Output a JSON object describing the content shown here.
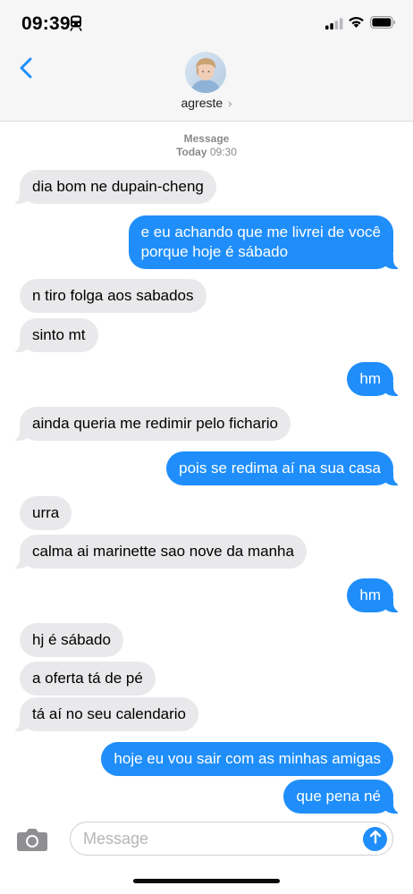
{
  "status_bar": {
    "time": "09:39",
    "icons": [
      "train-icon",
      "signal-icon",
      "wifi-icon",
      "battery-icon"
    ]
  },
  "header": {
    "back_icon": "chevron-left-icon",
    "contact_name": "agreste",
    "contact_chevron": "›"
  },
  "thread": {
    "service_label": "Message",
    "day": "Today",
    "time": "09:30"
  },
  "messages": [
    {
      "direction": "in",
      "text": "dia bom ne dupain-cheng"
    },
    {
      "direction": "out",
      "lines": [
        "e eu achando que me livrei de você",
        "porque hoje é sábado"
      ]
    },
    {
      "direction": "in",
      "text": "n tiro folga aos sabados"
    },
    {
      "direction": "in",
      "text": "sinto mt"
    },
    {
      "direction": "out",
      "text": "hm"
    },
    {
      "direction": "in",
      "text": "ainda queria me redimir pelo fichario"
    },
    {
      "direction": "out",
      "text": "pois se redima aí na sua casa"
    },
    {
      "direction": "in",
      "text": "urra"
    },
    {
      "direction": "in",
      "text": "calma ai marinette sao nove da manha"
    },
    {
      "direction": "out",
      "text": "hm"
    },
    {
      "direction": "in",
      "text": "hj é sábado"
    },
    {
      "direction": "in",
      "text": "a oferta tá de pé"
    },
    {
      "direction": "in",
      "text": "tá aí no seu calendario"
    },
    {
      "direction": "out",
      "text": "hoje eu vou sair com as minhas amigas"
    },
    {
      "direction": "out",
      "text": "que pena né"
    }
  ],
  "composer": {
    "placeholder": "Message",
    "value": "",
    "camera_icon": "camera-icon",
    "send_icon": "arrow-up-icon"
  },
  "colors": {
    "outgoing_bubble": "#1f8efa",
    "incoming_bubble": "#e9e9eb",
    "header_bg": "#f6f6f7"
  }
}
